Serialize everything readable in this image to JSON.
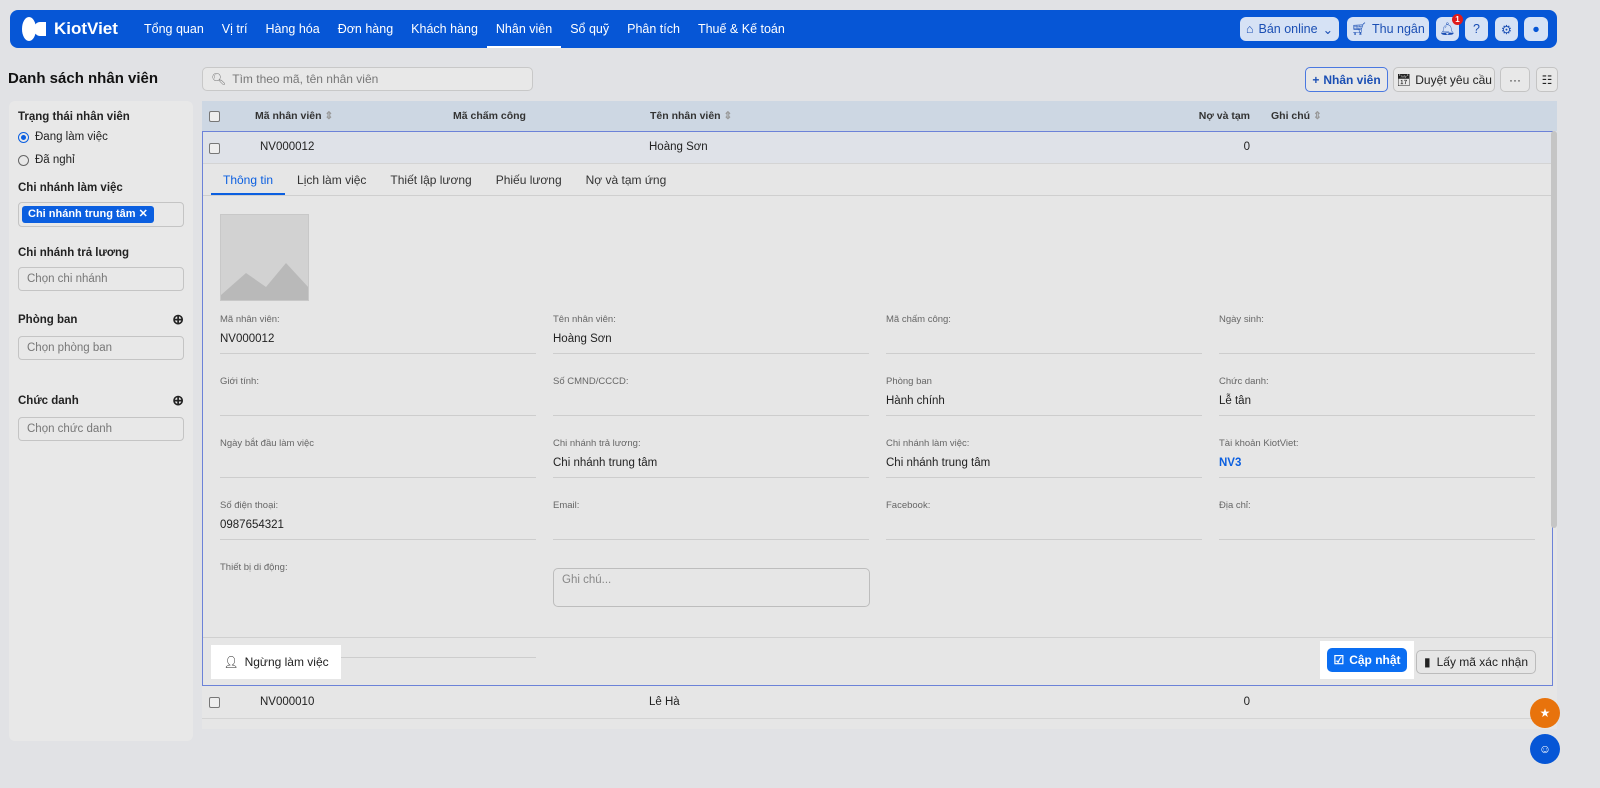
{
  "nav": {
    "brand": "KiotViet",
    "items": [
      "Tổng quan",
      "Vị trí",
      "Hàng hóa",
      "Đơn hàng",
      "Khách hàng",
      "Nhân viên",
      "Sổ quỹ",
      "Phân tích",
      "Thuế & Kế toán"
    ],
    "active": "Nhân viên",
    "ban_online": "Bán online",
    "thu_ngan": "Thu ngân",
    "notification_count": "1"
  },
  "page": {
    "title": "Danh sách nhân viên",
    "search_placeholder": "Tìm theo mã, tên nhân viên",
    "add_button": "Nhân viên",
    "approve_button": "Duyệt yêu cầu",
    "more_button": "···"
  },
  "sidebar": {
    "status_title": "Trạng thái nhân viên",
    "status_options": [
      "Đang làm việc",
      "Đã nghỉ"
    ],
    "branch_title": "Chi nhánh làm việc",
    "branch_tag": "Chi nhánh trung tâm",
    "pay_branch_title": "Chi nhánh trả lương",
    "pay_branch_placeholder": "Chọn chi nhánh",
    "dept_title": "Phòng ban",
    "dept_placeholder": "Chọn phòng ban",
    "title_title": "Chức danh",
    "title_placeholder": "Chọn chức danh"
  },
  "table": {
    "columns": [
      "Mã nhân viên",
      "Mã chấm công",
      "Tên nhân viên",
      "Nợ và tạm ứng",
      "Ghi chú"
    ],
    "rows": [
      {
        "code": "NV000012",
        "name": "Hoàng Sơn",
        "debt": "0"
      },
      {
        "code": "NV000010",
        "name": "Lê Hà",
        "debt": "0"
      }
    ]
  },
  "detail": {
    "tabs": [
      "Thông tin",
      "Lịch làm việc",
      "Thiết lập lương",
      "Phiếu lương",
      "Nợ và tạm ứng"
    ],
    "fields": [
      {
        "label": "Mã nhân viên:",
        "value": "NV000012"
      },
      {
        "label": "Tên nhân viên:",
        "value": "Hoàng Sơn"
      },
      {
        "label": "Mã chấm công:",
        "value": ""
      },
      {
        "label": "Ngày sinh:",
        "value": ""
      },
      {
        "label": "Giới tính:",
        "value": ""
      },
      {
        "label": "Số CMND/CCCD:",
        "value": ""
      },
      {
        "label": "Phòng ban",
        "value": "Hành chính"
      },
      {
        "label": "Chức danh:",
        "value": "Lễ tân"
      },
      {
        "label": "Ngày bắt đầu làm việc",
        "value": ""
      },
      {
        "label": "Chi nhánh trả lương:",
        "value": "Chi nhánh trung tâm"
      },
      {
        "label": "Chi nhánh làm việc:",
        "value": "Chi nhánh trung tâm"
      },
      {
        "label": "Tài khoản KiotViet:",
        "value": "NV3"
      },
      {
        "label": "Số điện thoại:",
        "value": "0987654321"
      },
      {
        "label": "Email:",
        "value": ""
      },
      {
        "label": "Facebook:",
        "value": ""
      },
      {
        "label": "Địa chỉ:",
        "value": ""
      },
      {
        "label": "Thiết bị di động:",
        "value": ""
      }
    ],
    "note_placeholder": "Ghi chú...",
    "stop_button": "Ngừng làm việc",
    "update_button": "Cập nhật",
    "code_button": "Lấy mã xác nhận"
  },
  "colors": {
    "brand": "#0656d6",
    "accent": "#0b5fe0",
    "fab_star": "#e8730c"
  }
}
